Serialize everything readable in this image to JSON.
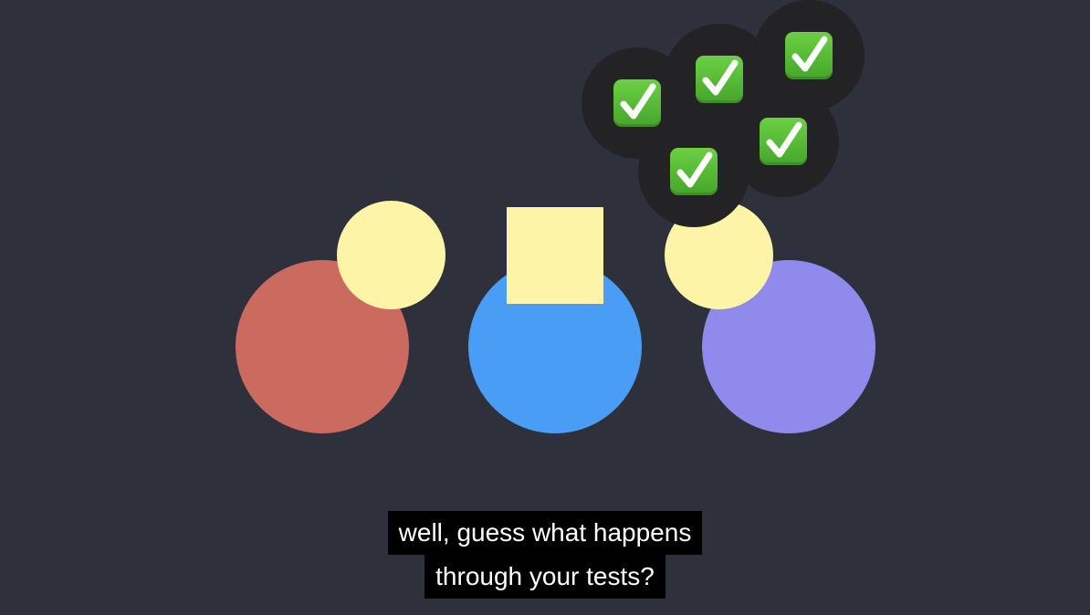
{
  "colors": {
    "background": "#2e313c",
    "red": "#cb6a5f",
    "blue": "#4a9df5",
    "purple": "#8f8aeb",
    "yellow": "#fdf4a8",
    "badge_bg": "#232326",
    "check_green": "#5bbf39"
  },
  "shapes": [
    {
      "name": "red-circle",
      "color": "red"
    },
    {
      "name": "blue-circle",
      "color": "blue"
    },
    {
      "name": "purple-circle",
      "color": "purple"
    },
    {
      "name": "yellow-circle-left",
      "color": "yellow"
    },
    {
      "name": "yellow-square",
      "color": "yellow"
    },
    {
      "name": "yellow-circle-right",
      "color": "yellow"
    }
  ],
  "badges": [
    {
      "icon": "check-mark-icon"
    },
    {
      "icon": "check-mark-icon"
    },
    {
      "icon": "check-mark-icon"
    },
    {
      "icon": "check-mark-icon"
    },
    {
      "icon": "check-mark-icon"
    }
  ],
  "captions": {
    "line1": "well, guess what happens",
    "line2": "through your tests?"
  }
}
